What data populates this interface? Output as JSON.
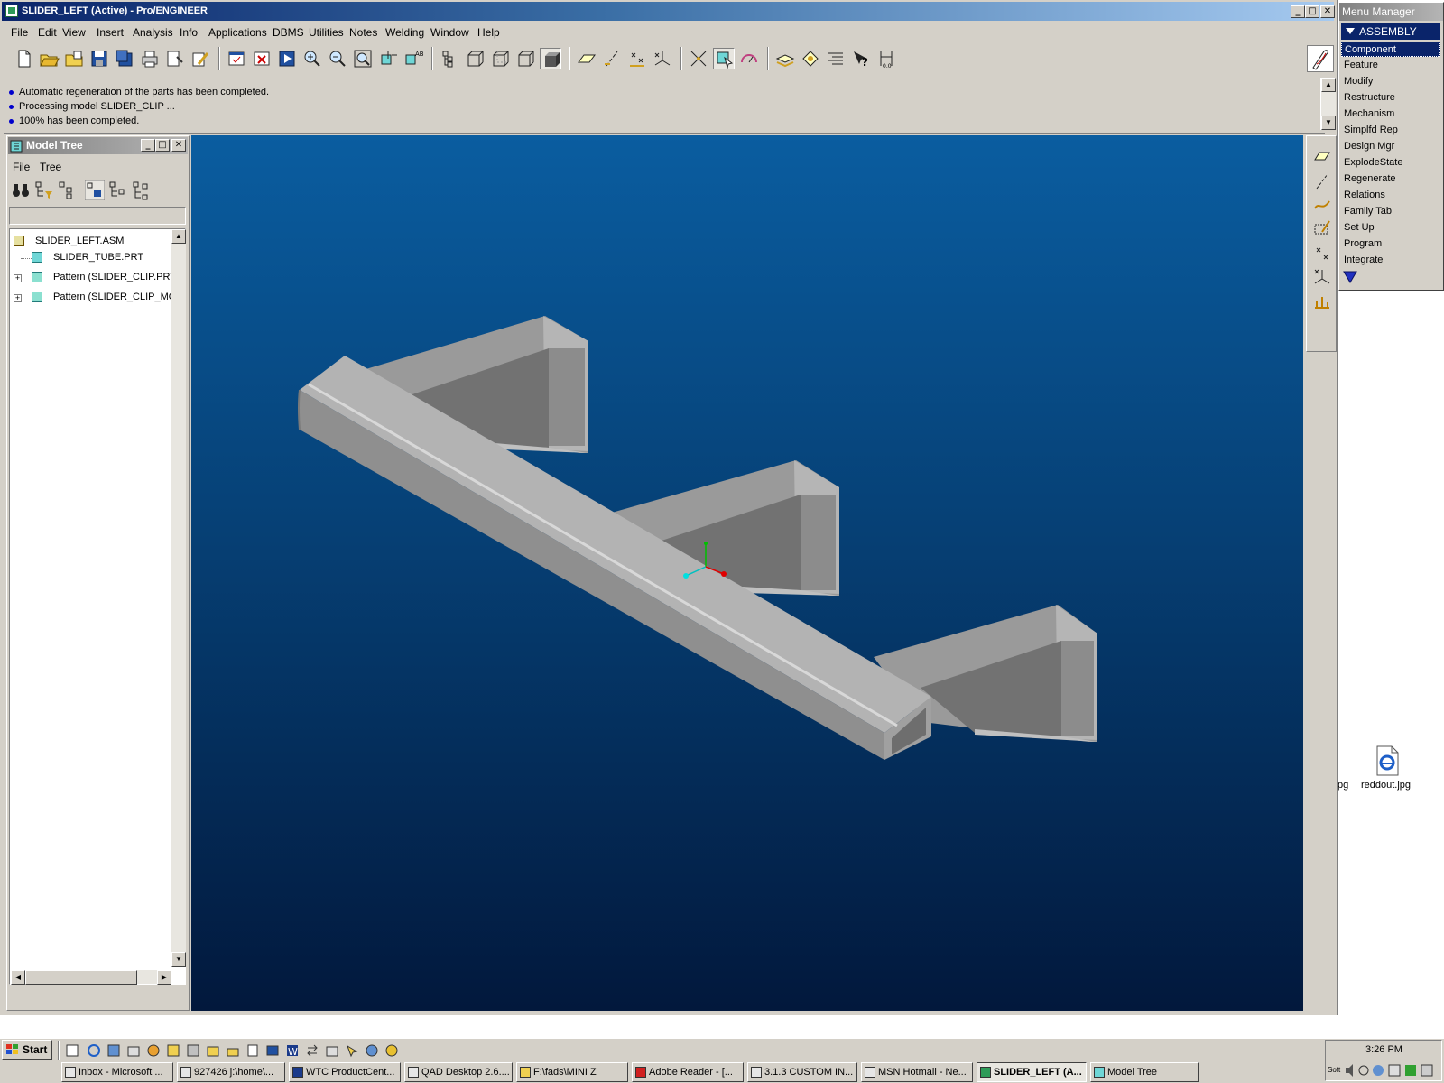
{
  "window": {
    "title": "SLIDER_LEFT (Active) - Pro/ENGINEER",
    "controls": {
      "minimize": "_",
      "maximize": "□",
      "close": "✕"
    }
  },
  "menubar": [
    "File",
    "Edit",
    "View",
    "Insert",
    "Analysis",
    "Info",
    "Applications",
    "DBMS",
    "Utilities",
    "Notes",
    "Welding",
    "Window",
    "Help"
  ],
  "toolbar": {
    "icons": [
      "new-icon",
      "open-icon",
      "open-folder-icon",
      "save-icon",
      "save-copy-icon",
      "print-icon",
      "print-preview-icon",
      "edit-icon",
      "window-icon",
      "close-window-icon",
      "activate-icon",
      "zoom-in-icon",
      "zoom-out-icon",
      "refit-icon",
      "orient-icon",
      "saved-views-icon",
      "model-tree-icon",
      "wireframe-icon",
      "hidden-line-icon",
      "no-hidden-icon",
      "shading-icon",
      "datum-plane-icon",
      "datum-axis-icon",
      "datum-point-icon",
      "coord-sys-icon",
      "spin-center-icon",
      "select-icon",
      "sketch-icon",
      "layers-icon",
      "style-icon",
      "align-icon",
      "whats-this-icon",
      "dimension-icon"
    ]
  },
  "messages": [
    "Automatic regeneration of the parts has been completed.",
    "Processing model SLIDER_CLIP ...",
    "100% has been completed."
  ],
  "model_tree": {
    "title": "Model Tree",
    "menu": [
      "File",
      "Tree"
    ],
    "items": [
      {
        "label": "SLIDER_LEFT.ASM",
        "expandable": false
      },
      {
        "label": "SLIDER_TUBE.PRT",
        "expandable": false
      },
      {
        "label": "Pattern (SLIDER_CLIP.PRT)",
        "expandable": true
      },
      {
        "label": "Pattern (SLIDER_CLIP_MOU",
        "expandable": true
      }
    ]
  },
  "menu_manager": {
    "title": "Menu Manager",
    "header": "ASSEMBLY",
    "items": [
      "Component",
      "Feature",
      "Modify",
      "Restructure",
      "Mechanism",
      "Simplfd Rep",
      "Design Mgr",
      "ExplodeState",
      "Regenerate",
      "Relations",
      "Family Tab",
      "Set Up",
      "Program",
      "Integrate"
    ],
    "selected": "Component"
  },
  "desktop": {
    "partial_label": "pg",
    "icon_label": "reddout.jpg"
  },
  "taskbar": {
    "start": "Start",
    "tasks": [
      {
        "label": "Inbox - Microsoft ...",
        "active": false
      },
      {
        "label": "927426  j:\\home\\...",
        "active": false
      },
      {
        "label": "WTC ProductCent...",
        "active": false
      },
      {
        "label": "QAD Desktop 2.6....",
        "active": false
      },
      {
        "label": "F:\\fads\\MINI Z",
        "active": false
      },
      {
        "label": "Adobe Reader - [...",
        "active": false
      },
      {
        "label": "3.1.3 CUSTOM IN...",
        "active": false
      },
      {
        "label": "MSN Hotmail - Ne...",
        "active": false
      },
      {
        "label": "SLIDER_LEFT (A...",
        "active": true
      },
      {
        "label": "Model Tree",
        "active": false
      }
    ],
    "clock": "3:26 PM",
    "tray_text": "Soft"
  },
  "colors": {
    "title_active": "#0a246a",
    "viewport_top": "#0a5da0",
    "viewport_bottom": "#02183c",
    "model_gray": "#a8a8a8"
  }
}
